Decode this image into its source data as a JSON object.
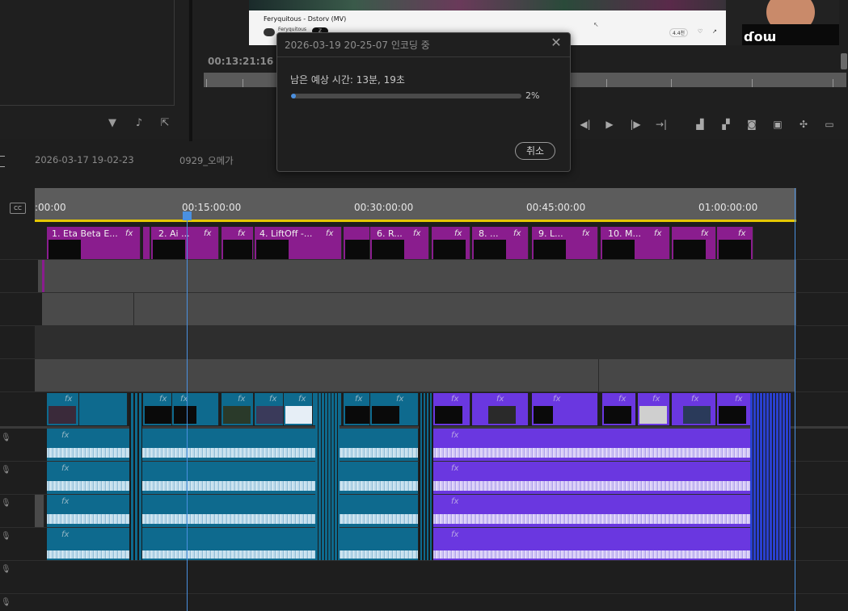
{
  "source_monitor": {
    "icons": [
      "filter-icon",
      "insert-audio-icon",
      "export-frame-icon"
    ]
  },
  "program_monitor": {
    "timecode": "00:13:21:16",
    "video_overlay": {
      "title": "Feryquitous - Dstorv (MV)",
      "channel": "Feryquitous",
      "badge": "ℤ",
      "likes": "4.4천"
    },
    "controls": [
      "step-back-icon",
      "play-icon",
      "step-forward-icon",
      "go-to-out-icon",
      "lift-icon",
      "extract-icon",
      "camera-icon",
      "compare-icon",
      "settings-icon",
      "safe-margins-icon"
    ]
  },
  "encoding_dialog": {
    "title": "2026-03-19 20-25-07 인코딩 중",
    "remaining_text": "남은 예상 시간: 13분, 19초",
    "progress_fraction": 0.02,
    "progress_label": "2%",
    "cancel_label": "취소",
    "close_icon": "close-icon"
  },
  "sequence_tabs": [
    {
      "label": "2026-03-17 19-02-23"
    },
    {
      "label": "0929_오메가"
    }
  ],
  "timeline": {
    "ruler_labels": [
      ":00:00",
      "00:15:00:00",
      "00:30:00:00",
      "00:45:00:00",
      "01:00:00:00"
    ],
    "clips_v3": [
      {
        "label": "1. Eta Beta E..."
      },
      {
        "label": "2. Ai ..."
      },
      {
        "label": ""
      },
      {
        "label": "4. LiftOff -..."
      },
      {
        "label": "6. R..."
      },
      {
        "label": ""
      },
      {
        "label": "8. ..."
      },
      {
        "label": "9. L..."
      },
      {
        "label": "10. M..."
      },
      {
        "label": ""
      },
      {
        "label": ""
      }
    ],
    "fx_label": "fx",
    "colors": {
      "purple_clip": "#8a1d8e",
      "teal_clip": "#0e6a8e",
      "violet_clip": "#6a37e0",
      "playhead": "#4a90e0"
    }
  }
}
